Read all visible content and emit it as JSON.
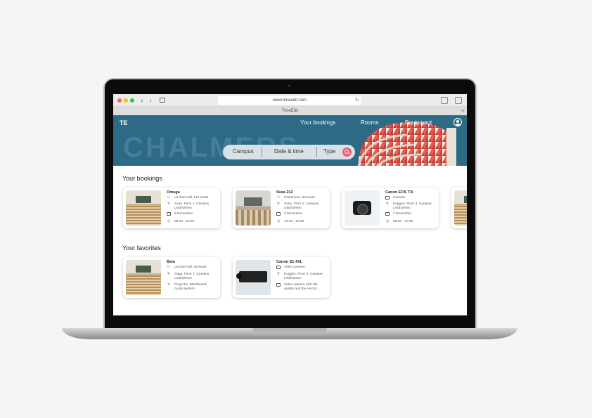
{
  "browser": {
    "url": "www.timeedit.com",
    "tab_title": "TimeEdit"
  },
  "header": {
    "logo": "TE",
    "hero_text": "CHALMERS",
    "nav": [
      "Your bookings",
      "Rooms",
      "Equipment"
    ]
  },
  "search": {
    "campus": "Campus",
    "datetime": "Date & time",
    "type": "Type"
  },
  "bookings": {
    "title": "Your bookings",
    "items": [
      {
        "name": "Omega",
        "rows": [
          "Lecture hall, 144 seats",
          "Svea, Floor 1, Campus Lindholmen",
          "6 December",
          "08:00 - 10:00"
        ]
      },
      {
        "name": "Svea 213",
        "rows": [
          "Classroom, 30 seats",
          "Svea, Floor 2, Campus Lindholmen",
          "6 December",
          "13:15 - 17:00"
        ]
      },
      {
        "name": "Canon EOS T3i",
        "rows": [
          "Camera",
          "Kuggen, Floor 3, Campus Lindholmen",
          "7 December",
          "08:00 - 17:00"
        ]
      }
    ]
  },
  "favorites": {
    "title": "Your favorites",
    "items": [
      {
        "name": "Beta",
        "rows": [
          "Lecture hall, 48 seats",
          "Saga, Floor 1, Campus Lindholmen",
          "Projector, Blackboard, Audio system..."
        ]
      },
      {
        "name": "Canon S1 4XL",
        "rows": [
          "Video camera",
          "Kuggen, Floor 3, Campus Lindholmen",
          "Video camera with HD quality and the record..."
        ]
      }
    ]
  }
}
